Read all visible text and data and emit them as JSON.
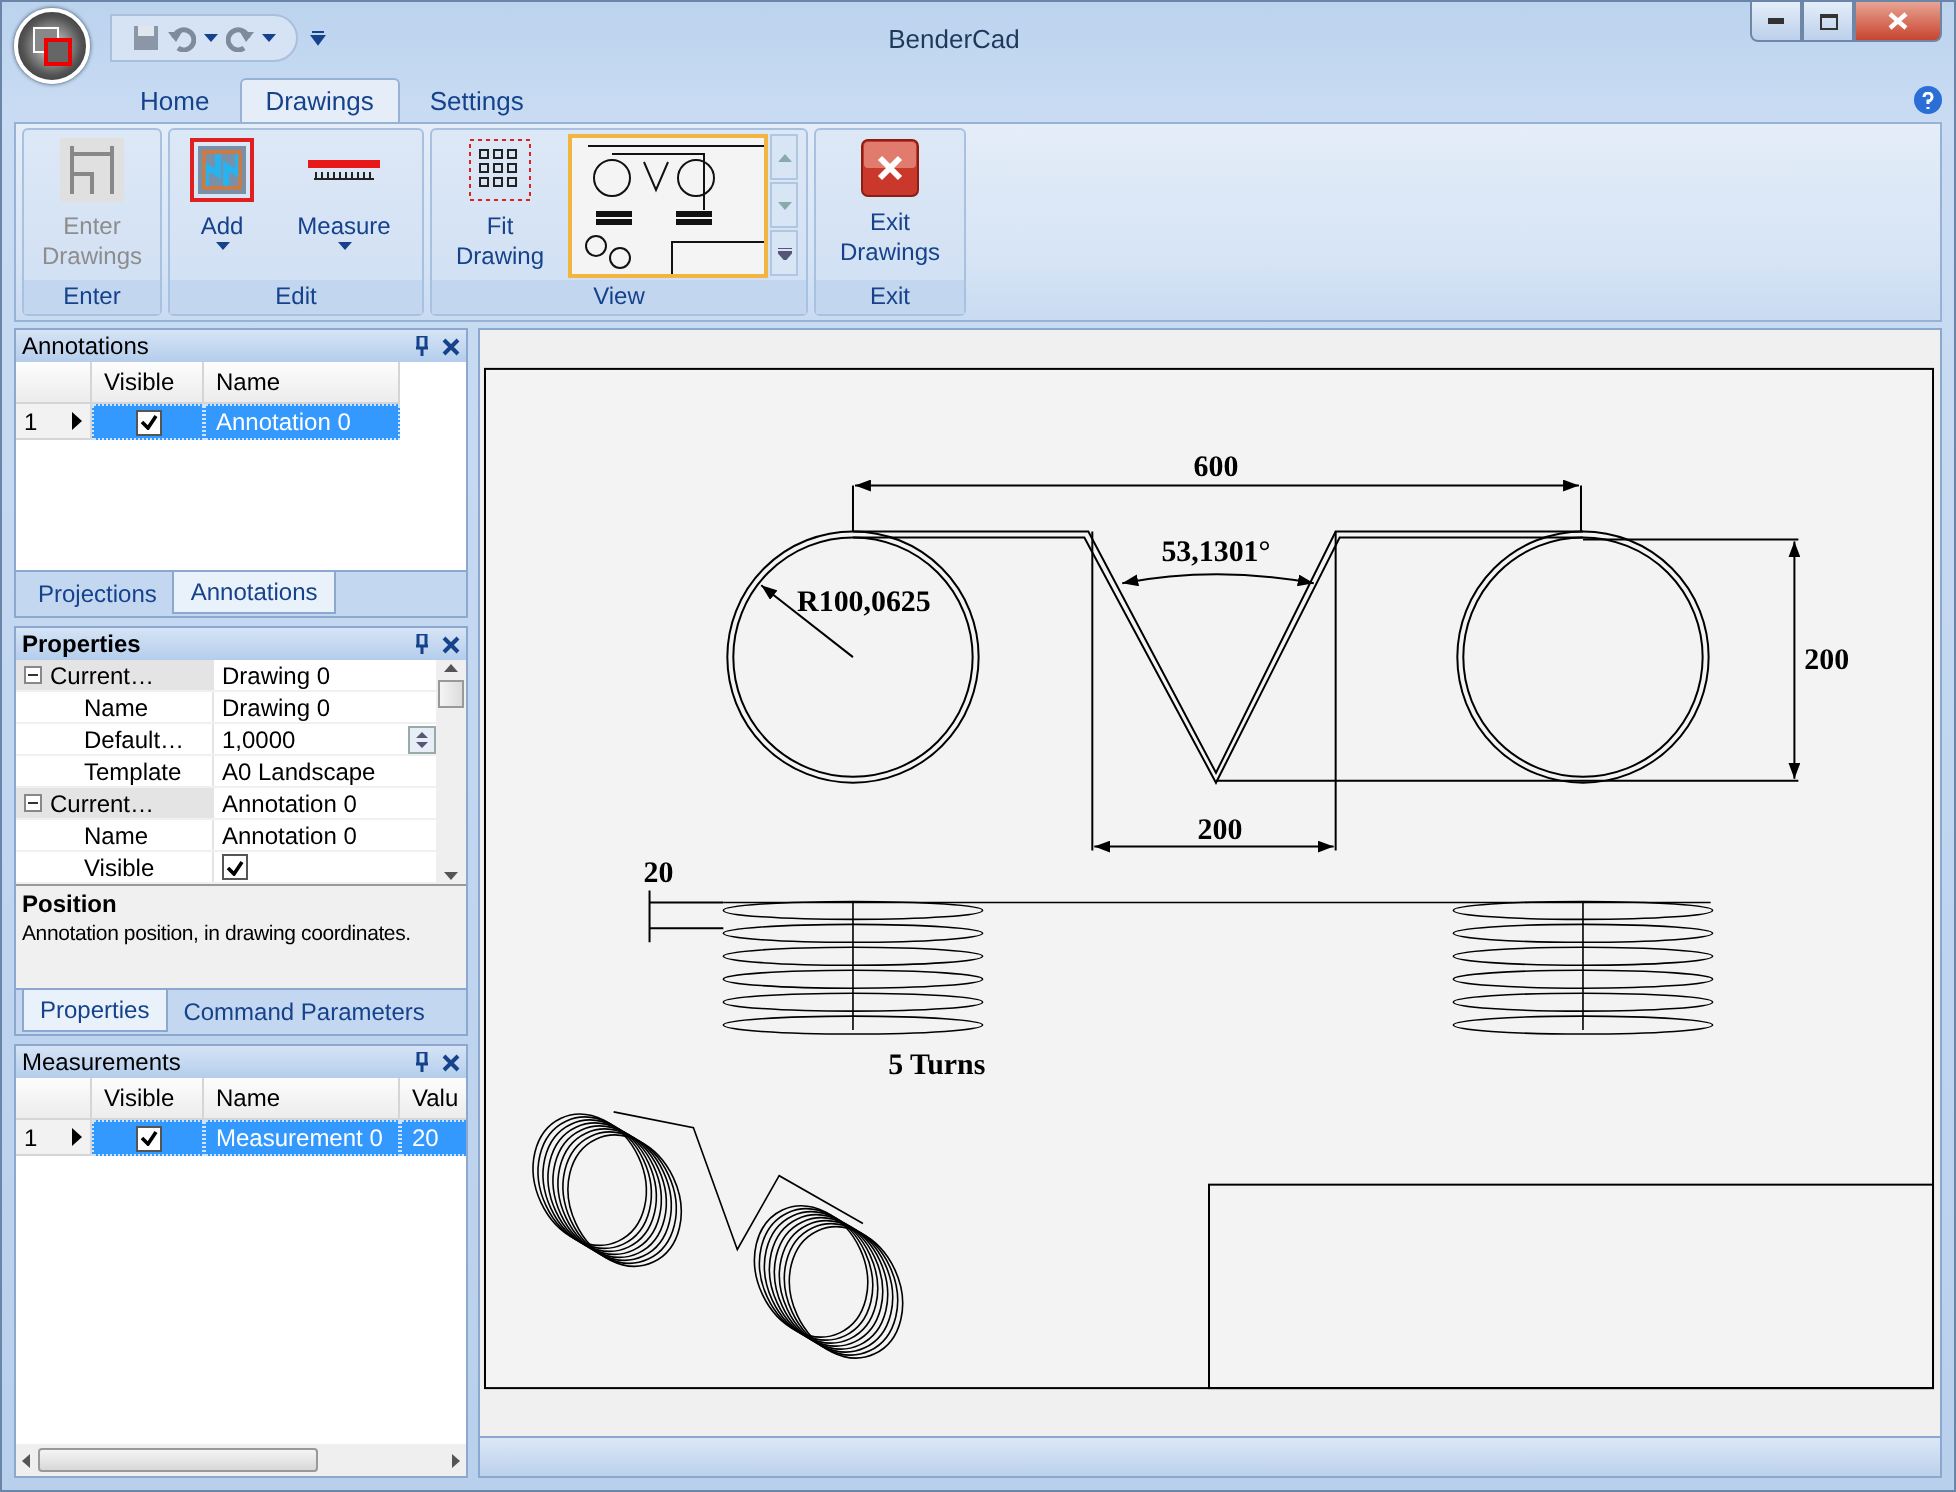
{
  "window": {
    "title": "BenderCad"
  },
  "ribbon": {
    "tabs": [
      {
        "label": "Home",
        "selected": false
      },
      {
        "label": "Drawings",
        "selected": true
      },
      {
        "label": "Settings",
        "selected": false
      }
    ],
    "groups": [
      {
        "label": "Enter",
        "items": [
          {
            "kind": "button",
            "label": "Enter Drawings",
            "disabled": true,
            "dropdown": false
          }
        ]
      },
      {
        "label": "Edit",
        "items": [
          {
            "kind": "button",
            "label": "Add",
            "disabled": false,
            "dropdown": true
          },
          {
            "kind": "button",
            "label": "Measure",
            "disabled": false,
            "dropdown": true
          }
        ]
      },
      {
        "label": "View",
        "items": [
          {
            "kind": "button",
            "label": "Fit Drawing",
            "disabled": false,
            "dropdown": false
          },
          {
            "kind": "gallery",
            "selected": true
          }
        ]
      },
      {
        "label": "Exit",
        "items": [
          {
            "kind": "button",
            "label": "Exit Drawings",
            "disabled": false,
            "dropdown": false
          }
        ]
      }
    ]
  },
  "annotations": {
    "title": "Annotations",
    "columns": {
      "visible": "Visible",
      "name": "Name"
    },
    "rows": [
      {
        "number": "1",
        "visible": true,
        "name": "Annotation 0",
        "selected": true
      }
    ],
    "tabs": [
      {
        "label": "Projections",
        "selected": false
      },
      {
        "label": "Annotations",
        "selected": true
      }
    ]
  },
  "properties": {
    "title": "Properties",
    "categories": [
      {
        "label": "Current…",
        "value": "Drawing 0",
        "expanded": true,
        "rows": [
          {
            "kind": "text",
            "name": "Name",
            "value": "Drawing 0"
          },
          {
            "kind": "spin",
            "name": "Default…",
            "value": "1,0000"
          },
          {
            "kind": "text",
            "name": "Template",
            "value": "A0 Landscape"
          }
        ]
      },
      {
        "label": "Current…",
        "value": "Annotation 0",
        "expanded": true,
        "rows": [
          {
            "kind": "text",
            "name": "Name",
            "value": "Annotation 0"
          },
          {
            "kind": "check",
            "name": "Visible",
            "checked": true
          }
        ]
      }
    ],
    "description": {
      "title": "Position",
      "text": "Annotation position, in drawing coordinates."
    },
    "tabs": [
      {
        "label": "Properties",
        "selected": true
      },
      {
        "label": "Command Parameters",
        "selected": false
      }
    ]
  },
  "measurements": {
    "title": "Measurements",
    "columns": {
      "visible": "Visible",
      "name": "Name",
      "value": "Valu"
    },
    "rows": [
      {
        "number": "1",
        "visible": true,
        "name": "Measurement 0",
        "value": "20",
        "selected": true
      }
    ]
  },
  "drawing": {
    "labels": [
      "600",
      "53,1301°",
      "R100,0625",
      "200",
      "200",
      "20",
      "5 Turns"
    ]
  }
}
